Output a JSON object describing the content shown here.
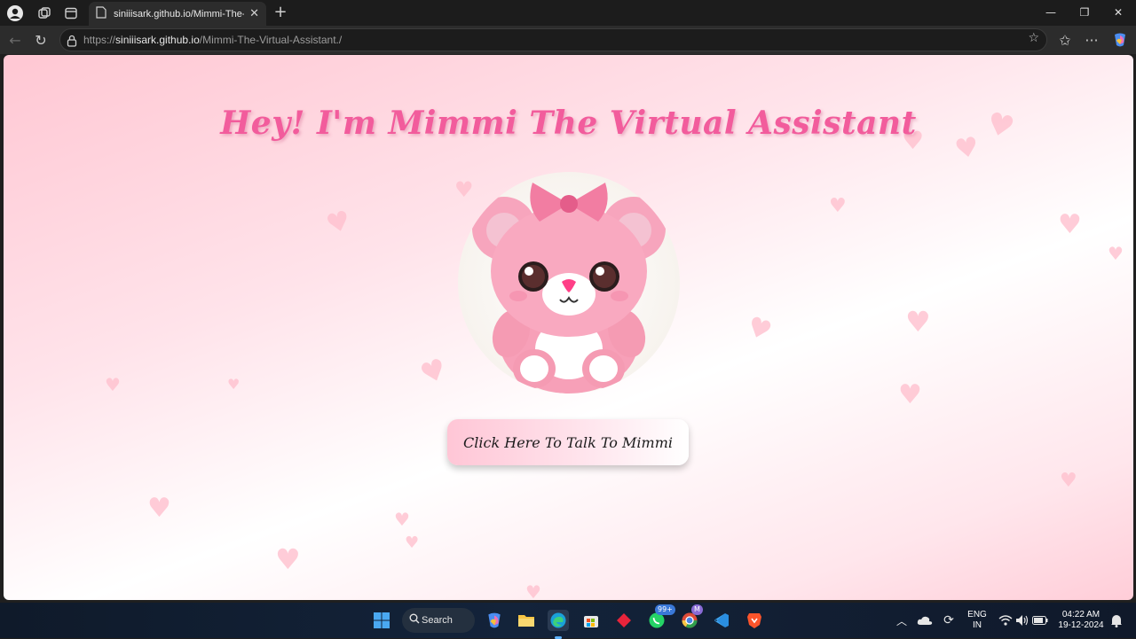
{
  "browser": {
    "tab_title": "siniiisark.github.io/Mimmi-The-Vi",
    "url_prefix": "https://",
    "url_host": "siniiisark.github.io",
    "url_path": "/Mimmi-The-Virtual-Assistant./"
  },
  "page": {
    "title": "Hey! I'm Mimmi The Virtual Assistant",
    "cta_label": "Click Here To Talk To Mimmi"
  },
  "taskbar": {
    "search_label": "Search",
    "whatsapp_badge": "99+",
    "chrome_badge": "M",
    "lang_top": "ENG",
    "lang_bottom": "IN",
    "time": "04:22 AM",
    "date": "19-12-2024"
  },
  "colors": {
    "title_pink": "#f25c9c",
    "page_bg_pink": "#ffc7d3"
  }
}
